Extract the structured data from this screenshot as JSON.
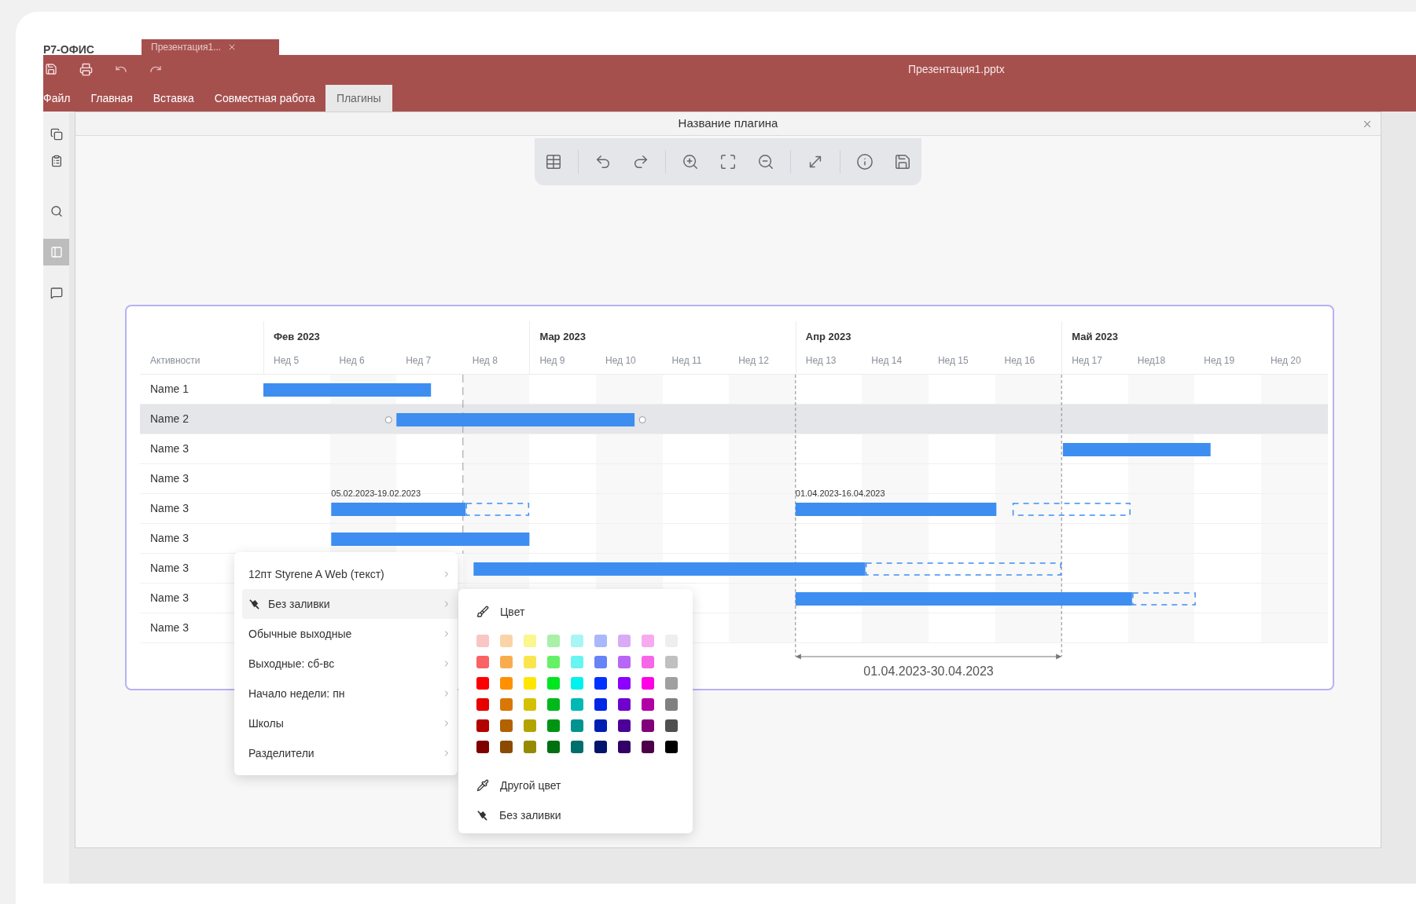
{
  "app": {
    "logo": "Р7-ОФИС",
    "document_tab": "Презентация1..."
  },
  "header": {
    "title": "Презентация1.pptx",
    "menu_tabs": [
      {
        "label": "Файл",
        "selected": false
      },
      {
        "label": "Главная",
        "selected": false
      },
      {
        "label": "Вставка",
        "selected": false
      },
      {
        "label": "Совместная работа",
        "selected": false
      },
      {
        "label": "Плагины",
        "selected": true
      }
    ]
  },
  "sidebar": {
    "items": [
      {
        "kind": "slides",
        "selected": false
      },
      {
        "kind": "notes",
        "selected": false
      },
      {
        "kind": "search",
        "selected": false
      },
      {
        "kind": "panel",
        "selected": true
      },
      {
        "kind": "comments",
        "selected": false
      }
    ]
  },
  "dialog": {
    "title": "Название плагина"
  },
  "gantt": {
    "activity_header": "Активности",
    "months": [
      "Фев 2023",
      "Мар 2023",
      "Апр 2023",
      "Май 2023"
    ],
    "rows": [
      {
        "label": "Name 1",
        "selected": false
      },
      {
        "label": "Name 2",
        "selected": true
      },
      {
        "label": "Name 3",
        "selected": false
      },
      {
        "label": "Name 3",
        "selected": false
      },
      {
        "label": "Name 3",
        "selected": false
      },
      {
        "label": "Name 3",
        "selected": false
      },
      {
        "label": "Name 3",
        "selected": false
      },
      {
        "label": "Name 3",
        "selected": false
      },
      {
        "label": "Name 3",
        "selected": false
      }
    ],
    "weeks": [
      "Нед 5",
      "Нед 6",
      "Нед 7",
      "Нед 8",
      "Нед 9",
      "Нед 10",
      "Нед 11",
      "Нед 12",
      "Нед 13",
      "Нед 14",
      "Нед 15",
      "Нед 16",
      "Нед 17",
      "Нед18",
      "Нед 19",
      "Нед 20"
    ],
    "bar_labels": [
      "05.02.2023-19.02.2023",
      "01.04.2023-16.04.2023"
    ],
    "range_label": "01.04.2023-30.04.2023"
  },
  "context_menu": {
    "items": [
      {
        "label": "12пт Styrene A Web (текст)",
        "kind": "plain",
        "selected": false
      },
      {
        "label": "Без заливки",
        "kind": "nofill",
        "selected": true
      },
      {
        "label": "Обычные выходные",
        "kind": "plain",
        "selected": false
      },
      {
        "label": "Выходные: сб-вс",
        "kind": "plain",
        "selected": false
      },
      {
        "label": "Начало недели: пн",
        "kind": "plain",
        "selected": false
      },
      {
        "label": "Школы",
        "kind": "plain",
        "selected": false
      },
      {
        "label": "Разделители",
        "kind": "plain",
        "selected": false
      }
    ]
  },
  "color_submenu": {
    "title": "Цвет",
    "swatch_rows": [
      {
        "swatches": [
          {
            "color": "#f9c6c6"
          },
          {
            "color": "#fad4a8"
          },
          {
            "color": "#fbf68d"
          },
          {
            "color": "#a9f0a8"
          },
          {
            "color": "#a8f5f5"
          },
          {
            "color": "#a9b8fa"
          },
          {
            "color": "#d9aaf5"
          },
          {
            "color": "#f7aaf0"
          },
          {
            "color": "#eeeeee"
          }
        ]
      },
      {
        "swatches": [
          {
            "color": "#f96363"
          },
          {
            "color": "#f9ac4d"
          },
          {
            "color": "#fbe54f"
          },
          {
            "color": "#66f066"
          },
          {
            "color": "#66f5f2"
          },
          {
            "color": "#6683f7"
          },
          {
            "color": "#b866f5"
          },
          {
            "color": "#f666e8"
          },
          {
            "color": "#c0c0c0"
          }
        ]
      },
      {
        "swatches": [
          {
            "color": "#ff0000"
          },
          {
            "color": "#ff9000"
          },
          {
            "color": "#ffe600"
          },
          {
            "color": "#00e61f"
          },
          {
            "color": "#00f2ee"
          },
          {
            "color": "#0033ff"
          },
          {
            "color": "#8c00ff"
          },
          {
            "color": "#ff00e6"
          },
          {
            "color": "#a0a0a0"
          }
        ]
      },
      {
        "swatches": [
          {
            "color": "#e60000"
          },
          {
            "color": "#d97706"
          },
          {
            "color": "#d4c000"
          },
          {
            "color": "#00b81a"
          },
          {
            "color": "#00b8b4"
          },
          {
            "color": "#0026e6"
          },
          {
            "color": "#7000cc"
          },
          {
            "color": "#b000a6"
          },
          {
            "color": "#808080"
          }
        ]
      },
      {
        "swatches": [
          {
            "color": "#b30000"
          },
          {
            "color": "#b36200"
          },
          {
            "color": "#b3a300"
          },
          {
            "color": "#009415"
          },
          {
            "color": "#009490"
          },
          {
            "color": "#001fb3"
          },
          {
            "color": "#4d0099"
          },
          {
            "color": "#80007a"
          },
          {
            "color": "#505050"
          }
        ]
      },
      {
        "swatches": [
          {
            "color": "#800000"
          },
          {
            "color": "#8a4a00"
          },
          {
            "color": "#968a00"
          },
          {
            "color": "#007010"
          },
          {
            "color": "#006e6b"
          },
          {
            "color": "#00156b"
          },
          {
            "color": "#330066"
          },
          {
            "color": "#4d0047"
          },
          {
            "color": "#000000"
          }
        ]
      }
    ],
    "actions": [
      {
        "label": "Другой цвет",
        "kind": "picker"
      },
      {
        "label": "Без заливки",
        "kind": "nofill"
      }
    ]
  }
}
